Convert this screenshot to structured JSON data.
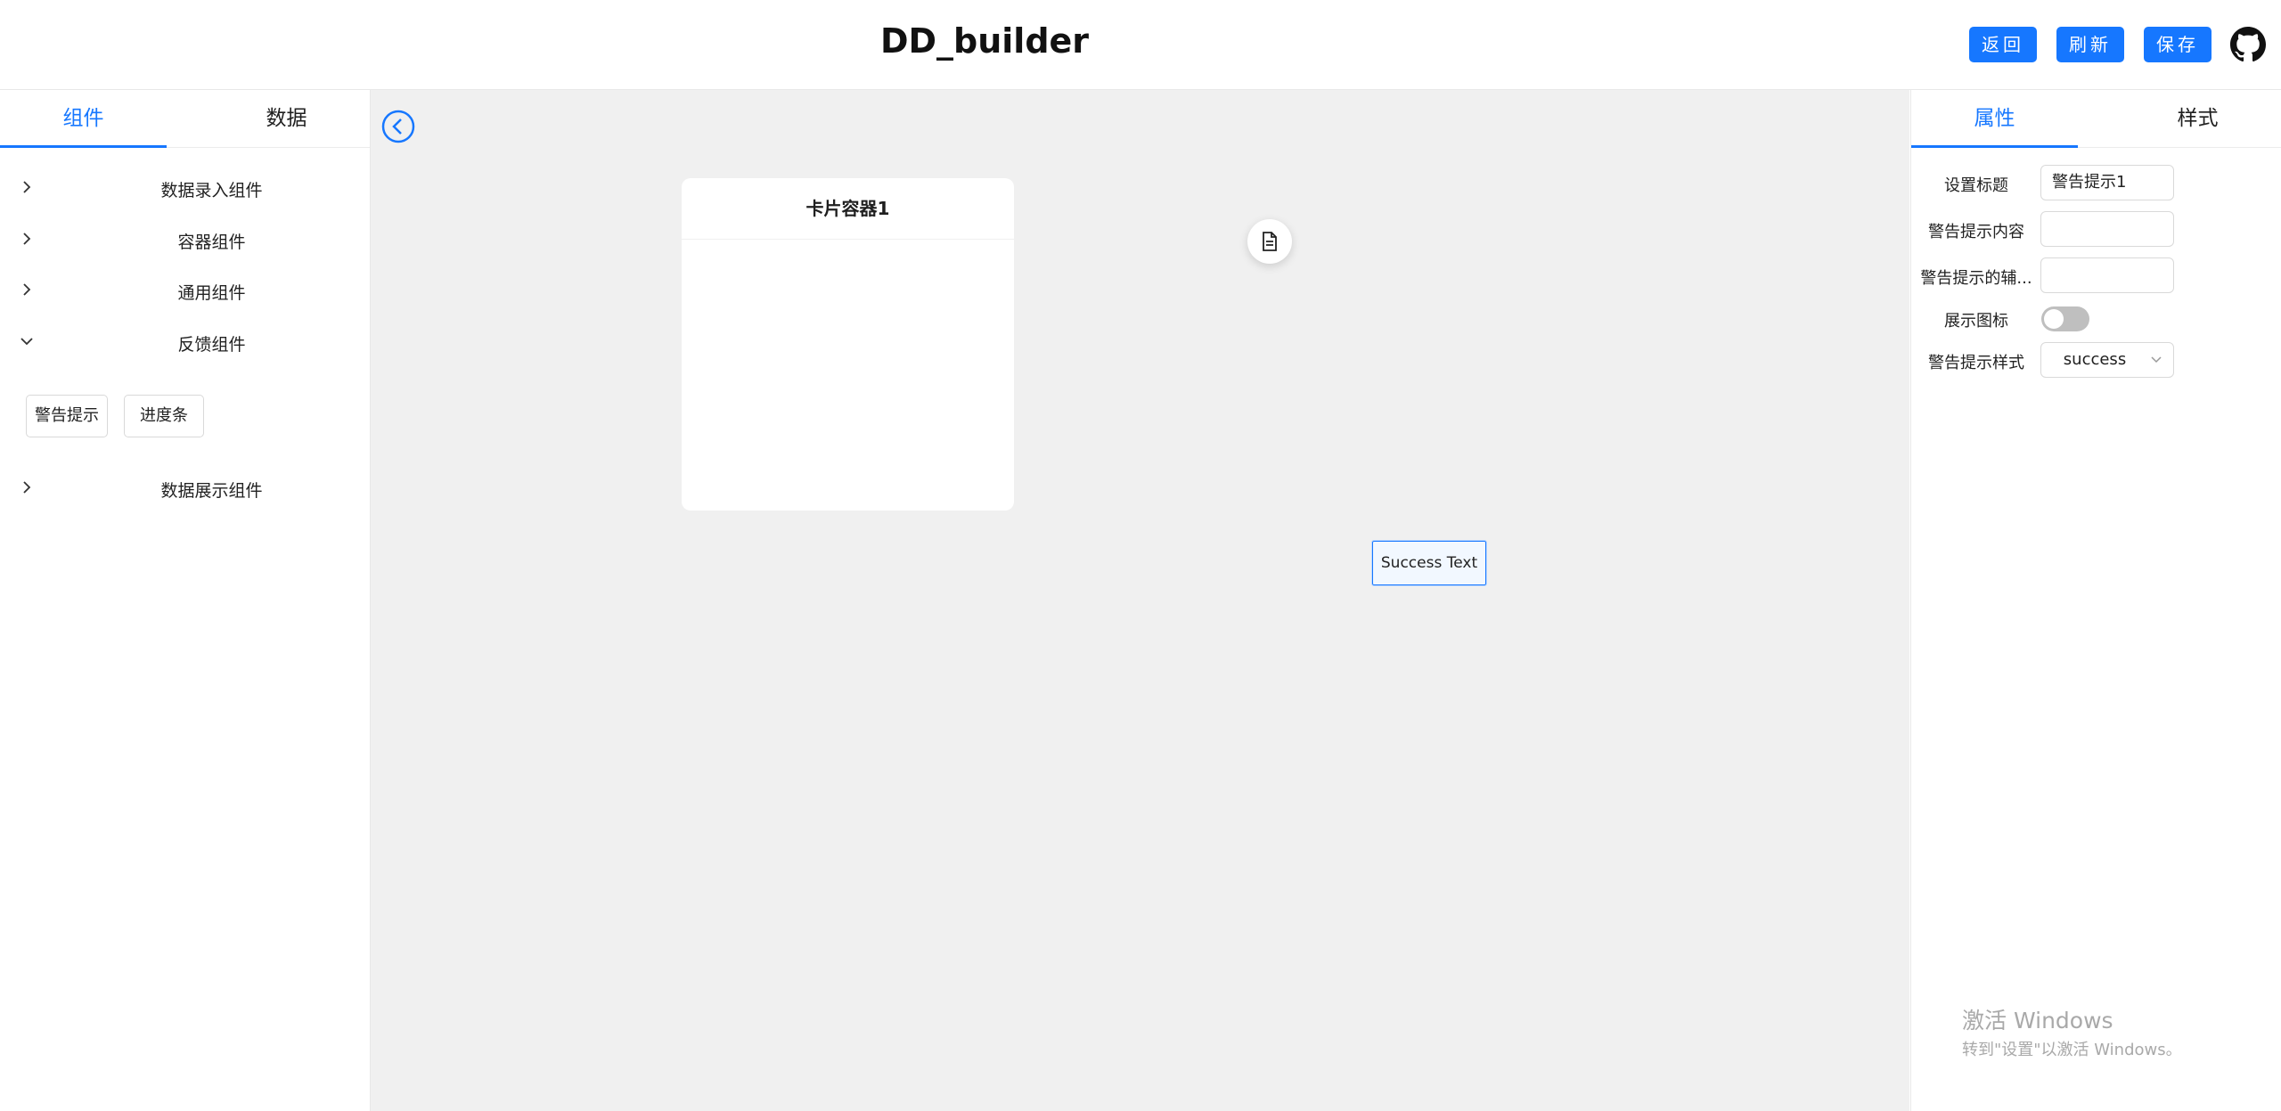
{
  "header": {
    "title": "DD_builder",
    "buttons": {
      "back": "返回",
      "refresh": "刷新",
      "save": "保存"
    },
    "accent_color": "#1677ff"
  },
  "left_panel": {
    "tabs": [
      "组件",
      "数据"
    ],
    "active_tab": "组件",
    "groups": [
      {
        "label": "数据录入组件",
        "expanded": false
      },
      {
        "label": "容器组件",
        "expanded": false
      },
      {
        "label": "通用组件",
        "expanded": false
      },
      {
        "label": "反馈组件",
        "expanded": true,
        "items": [
          "警告提示",
          "进度条"
        ]
      },
      {
        "label": "数据展示组件",
        "expanded": false
      }
    ]
  },
  "canvas": {
    "card_title": "卡片容器1",
    "alert_text": "Success Text",
    "background": "#f0f0f0"
  },
  "right_panel": {
    "tabs": [
      "属性",
      "样式"
    ],
    "active_tab": "属性",
    "fields": {
      "title_label": "设置标题",
      "title_value": "警告提示1",
      "content_label": "警告提示内容",
      "content_value": "",
      "desc_label": "警告提示的辅...",
      "desc_value": "",
      "show_icon_label": "展示图标",
      "show_icon": false,
      "style_label": "警告提示样式",
      "style_value": "success"
    }
  },
  "watermark": {
    "title": "激活 Windows",
    "subtitle": "转到\"设置\"以激活 Windows。"
  }
}
